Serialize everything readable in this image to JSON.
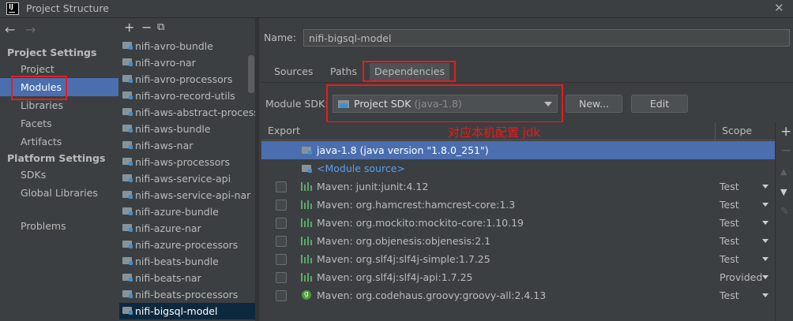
{
  "window": {
    "title": "Project Structure",
    "app_icon_text": "IJ"
  },
  "nav": {
    "section_project": "Project Settings",
    "project_items": [
      "Project",
      "Modules",
      "Libraries",
      "Facets",
      "Artifacts"
    ],
    "section_platform": "Platform Settings",
    "platform_items": [
      "SDKs",
      "Global Libraries"
    ],
    "problems": "Problems",
    "selected": "Modules"
  },
  "modules": {
    "items": [
      "nifi-avro-bundle",
      "nifi-avro-nar",
      "nifi-avro-processors",
      "nifi-avro-record-utils",
      "nifi-aws-abstract-processors",
      "nifi-aws-bundle",
      "nifi-aws-nar",
      "nifi-aws-processors",
      "nifi-aws-service-api",
      "nifi-aws-service-api-nar",
      "nifi-azure-bundle",
      "nifi-azure-nar",
      "nifi-azure-processors",
      "nifi-beats-bundle",
      "nifi-beats-nar",
      "nifi-beats-processors",
      "nifi-bigsql-model"
    ],
    "selected": "nifi-bigsql-model"
  },
  "detail": {
    "name_label": "Name:",
    "name_value": "nifi-bigsql-model",
    "tabs": [
      "Sources",
      "Paths",
      "Dependencies"
    ],
    "active_tab": "Dependencies",
    "sdk_label": "Module SDK:",
    "sdk_value": "Project SDK",
    "sdk_value_detail": "(java-1.8)",
    "new_button": "New...",
    "edit_button": "Edit",
    "annotation": "对应本机配置 jdk"
  },
  "table": {
    "col_export": "Export",
    "col_scope": "Scope",
    "rows": [
      {
        "kind": "jdk",
        "text": "java-1.8 (java version \"1.8.0_251\")",
        "scope": ""
      },
      {
        "kind": "source",
        "text": "<Module source>",
        "scope": ""
      },
      {
        "kind": "maven",
        "text": "Maven: junit:junit:4.12",
        "scope": "Test"
      },
      {
        "kind": "maven",
        "text": "Maven: org.hamcrest:hamcrest-core:1.3",
        "scope": "Test"
      },
      {
        "kind": "maven",
        "text": "Maven: org.mockito:mockito-core:1.10.19",
        "scope": "Test"
      },
      {
        "kind": "maven",
        "text": "Maven: org.objenesis:objenesis:2.1",
        "scope": "Test"
      },
      {
        "kind": "maven",
        "text": "Maven: org.slf4j:slf4j-simple:1.7.25",
        "scope": "Test"
      },
      {
        "kind": "maven",
        "text": "Maven: org.slf4j:slf4j-api:1.7.25",
        "scope": "Provided"
      },
      {
        "kind": "groovy",
        "text": "Maven: org.codehaus.groovy:groovy-all:2.4.13",
        "scope": "Test"
      }
    ]
  },
  "colors": {
    "selection": "#4b6eaf",
    "highlight": "#e81c1c",
    "link": "#589df6",
    "background": "#3c3f41"
  }
}
